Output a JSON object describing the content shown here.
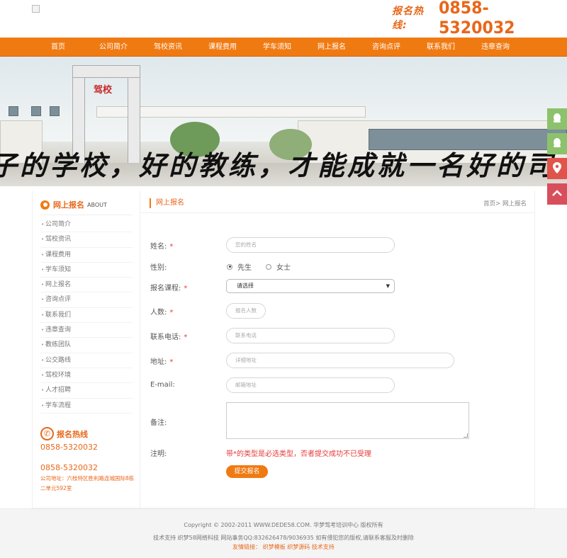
{
  "header": {
    "hotline_label": "报名热线:",
    "hotline_number": "0858-5320032"
  },
  "nav": {
    "items": [
      "首页",
      "公司简介",
      "驾校资讯",
      "课程费用",
      "学车须知",
      "网上报名",
      "咨询点评",
      "联系我们",
      "违章查询"
    ]
  },
  "banner": {
    "slogan": "子的学校，好的教练，才能成就一名好的司",
    "sign_text": "驾校"
  },
  "sidebar": {
    "title": "网上报名",
    "title_en": "ABOUT",
    "items": [
      "公司简介",
      "驾校资讯",
      "课程费用",
      "学车须知",
      "网上报名",
      "咨询点评",
      "联系我们",
      "违章查询",
      "教练团队",
      "公交路线",
      "驾校环境",
      "人才招聘",
      "学车流程"
    ],
    "hotline_title": "报名热线",
    "hotline_number_1": "0858-5320032",
    "hotline_number_2": "0858-5320032",
    "address": "公司地址：六枝特区胜利路连城国际8栋二单元592室"
  },
  "main": {
    "section_title": "网上报名",
    "breadcrumb_home": "首页",
    "breadcrumb_sep": ">",
    "breadcrumb_current": "网上报名",
    "form": {
      "name_label": "姓名:",
      "name_placeholder": "您的姓名",
      "gender_label": "性别:",
      "gender_male": "先生",
      "gender_female": "女士",
      "course_label": "报名课程:",
      "course_selected": "请选择",
      "count_label": "人数:",
      "count_placeholder": "报名人数",
      "phone_label": "联系电话:",
      "phone_placeholder": "联系电话",
      "address_label": "地址:",
      "address_placeholder": "详细地址",
      "email_label": "E-mail:",
      "email_placeholder": "邮箱地址",
      "remark_label": "备注:",
      "note_label": "注明:",
      "note_text": "带*的类型是必选类型，否者提交成功不已受理",
      "required_mark": "*",
      "submit_label": "提交报名"
    }
  },
  "footer": {
    "copyright": "Copyright © 2002-2011 WWW.DEDE58.COM. 华梦驾考培训中心 版权所有",
    "support": "技术支持 织梦58网络科技 网站事务QQ:832626478/9036935 如有侵犯您的版权,请联系客服及时删除",
    "links_label": "友情链接：",
    "links": [
      "织梦模板",
      "织梦源码",
      "技术支持"
    ]
  },
  "colors": {
    "accent": "#f07a12",
    "required": "#e53935",
    "qq_float": "#8cc26c",
    "map_float": "#e0544b",
    "top_float": "#d84f5c"
  },
  "icons": [
    "flame-icon",
    "phone-icon",
    "qq-icon",
    "map-pin-icon",
    "back-to-top-icon"
  ]
}
